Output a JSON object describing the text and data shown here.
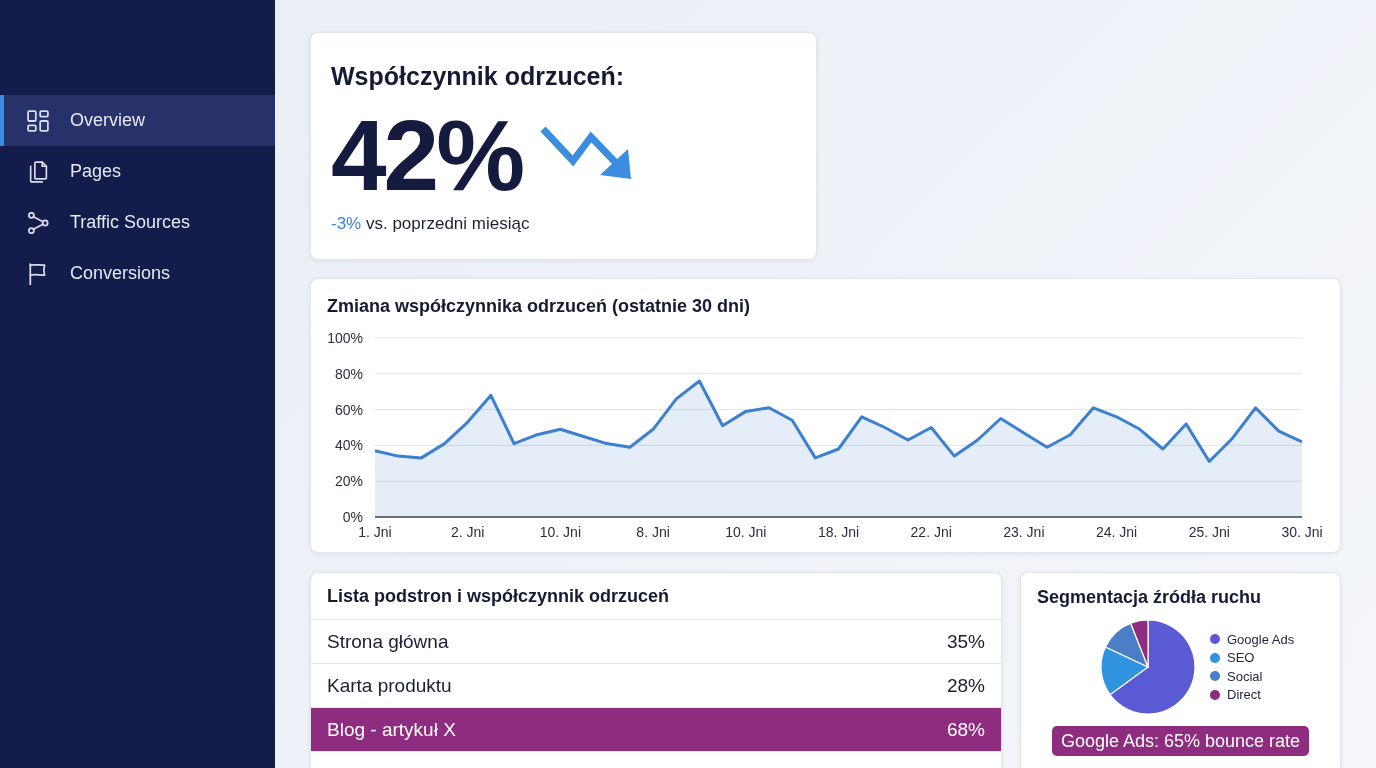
{
  "sidebar": {
    "items": [
      {
        "label": "Overview",
        "selected": true
      },
      {
        "label": "Pages",
        "selected": false
      },
      {
        "label": "Traffic Sources",
        "selected": false
      },
      {
        "label": "Conversions",
        "selected": false
      }
    ]
  },
  "kpi_card": {
    "title": "Współczynnik odrzuceń:",
    "value": "42%",
    "change": "-3%",
    "comparison": "vs. poprzedni miesiąc"
  },
  "trend_chart": {
    "chart_data": {
      "type": "area",
      "title": "Zmiana współczynnika odrzuceń (ostatnie 30 dni)",
      "categories": [
        "1. Jni",
        null,
        null,
        null,
        "2. Jni",
        null,
        null,
        null,
        "10. Jni",
        null,
        null,
        null,
        "8. Jni",
        null,
        null,
        null,
        "10. Jni",
        null,
        null,
        null,
        "18. Jni",
        null,
        null,
        null,
        "22. Jni",
        null,
        null,
        null,
        "23. Jni",
        null,
        null,
        null,
        "24. Jni",
        null,
        null,
        null,
        "25. Jni",
        null,
        null,
        null,
        "30. Jni"
      ],
      "ylim": [
        0,
        100
      ],
      "yticks": [
        {
          "value": 0,
          "label": "0%"
        },
        {
          "value": 20,
          "label": "20%"
        },
        {
          "value": 40,
          "label": "40%"
        },
        {
          "value": 60,
          "label": "60%"
        },
        {
          "value": 80,
          "label": "80%"
        },
        {
          "value": 100,
          "label": "100%"
        }
      ],
      "grid": true,
      "series": [
        {
          "color": "#3d7fd0",
          "values": [
            37,
            34,
            33,
            41,
            53,
            68,
            41,
            46,
            49,
            45,
            41,
            39,
            49,
            66,
            76,
            51,
            59,
            61,
            54,
            33,
            38,
            56,
            50,
            43,
            50,
            34,
            43,
            55,
            47,
            39,
            46,
            61,
            56,
            49,
            38,
            52,
            31,
            44,
            61,
            48,
            42
          ]
        }
      ]
    }
  },
  "pages_list": {
    "title": "Lista podstron i współczynnik odrzuceń",
    "rows": [
      {
        "page": "Strona główna",
        "rate": "35%",
        "selected": false
      },
      {
        "page": "Karta produktu",
        "rate": "28%",
        "selected": false
      },
      {
        "page": "Blog - artykuł X",
        "rate": "68%",
        "selected": true
      }
    ]
  },
  "traffic_segmentation": {
    "chart_data": {
      "type": "pie",
      "title": "Segmentacja źródła ruchu",
      "categories": [
        "Google Ads",
        "SEO",
        "Social",
        "Direct"
      ],
      "values": [
        65,
        17,
        12,
        6
      ],
      "legend": "right"
    },
    "segments": [
      {
        "color": "#5a5ad4"
      },
      {
        "color": "#2f93e0"
      },
      {
        "color": "#4a7ec6"
      },
      {
        "color": "#8e2c7f"
      }
    ],
    "callout": "Google Ads: 65% bounce rate"
  }
}
